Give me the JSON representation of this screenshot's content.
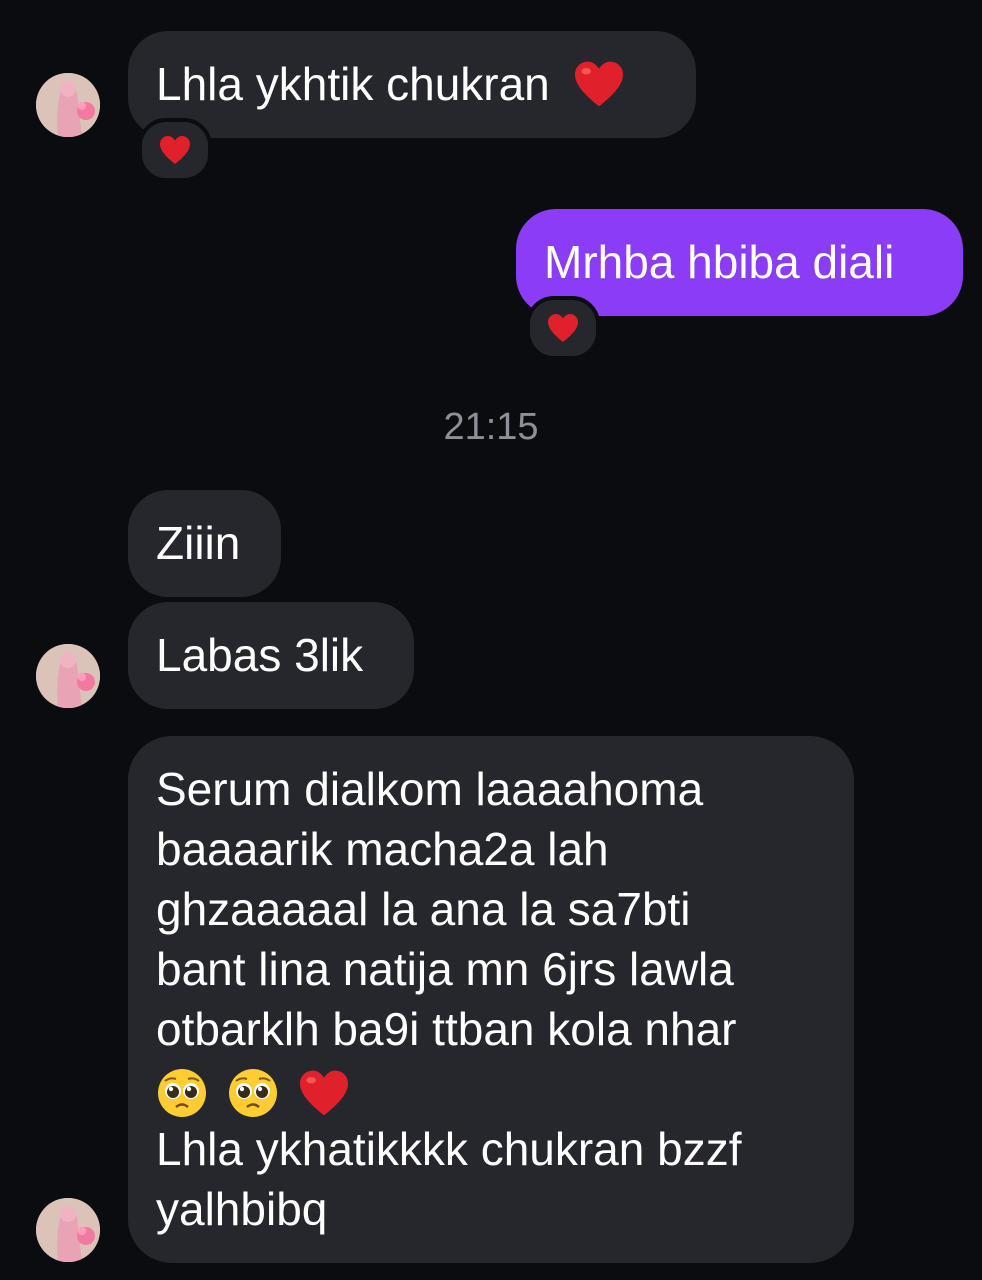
{
  "messages": [
    {
      "id": "m1",
      "sender": "contact",
      "text": "Lhla ykhtik chukran",
      "emoji_suffix": "heart-icon",
      "reaction": "heart-icon"
    },
    {
      "id": "m2",
      "sender": "me",
      "text": "Mrhba hbiba diali",
      "reaction": "heart-icon"
    },
    {
      "id": "m3",
      "sender": "contact",
      "text": "Ziiin"
    },
    {
      "id": "m4",
      "sender": "contact",
      "text": "Labas 3lik"
    },
    {
      "id": "m5",
      "sender": "contact",
      "lines": [
        "Serum dialkom laaaahoma",
        "baaaarik macha2a lah",
        "ghzaaaaal la ana la sa7bti",
        "bant lina natija  mn 6jrs lawla",
        "otbarklh ba9i ttban kola nhar"
      ],
      "emoji_line": [
        "pleading-face-icon",
        "pleading-face-icon",
        "heart-icon"
      ],
      "lines_after": [
        "Lhla ykhatikkkk chukran bzzf",
        "yalhbibq"
      ]
    }
  ],
  "timestamp": "21:15",
  "colors": {
    "background": "#0b0c10",
    "received_bubble": "#26272c",
    "sent_bubble": "#8b3cf7",
    "heart": "#e0202b",
    "timestamp_text": "#8e9098"
  }
}
